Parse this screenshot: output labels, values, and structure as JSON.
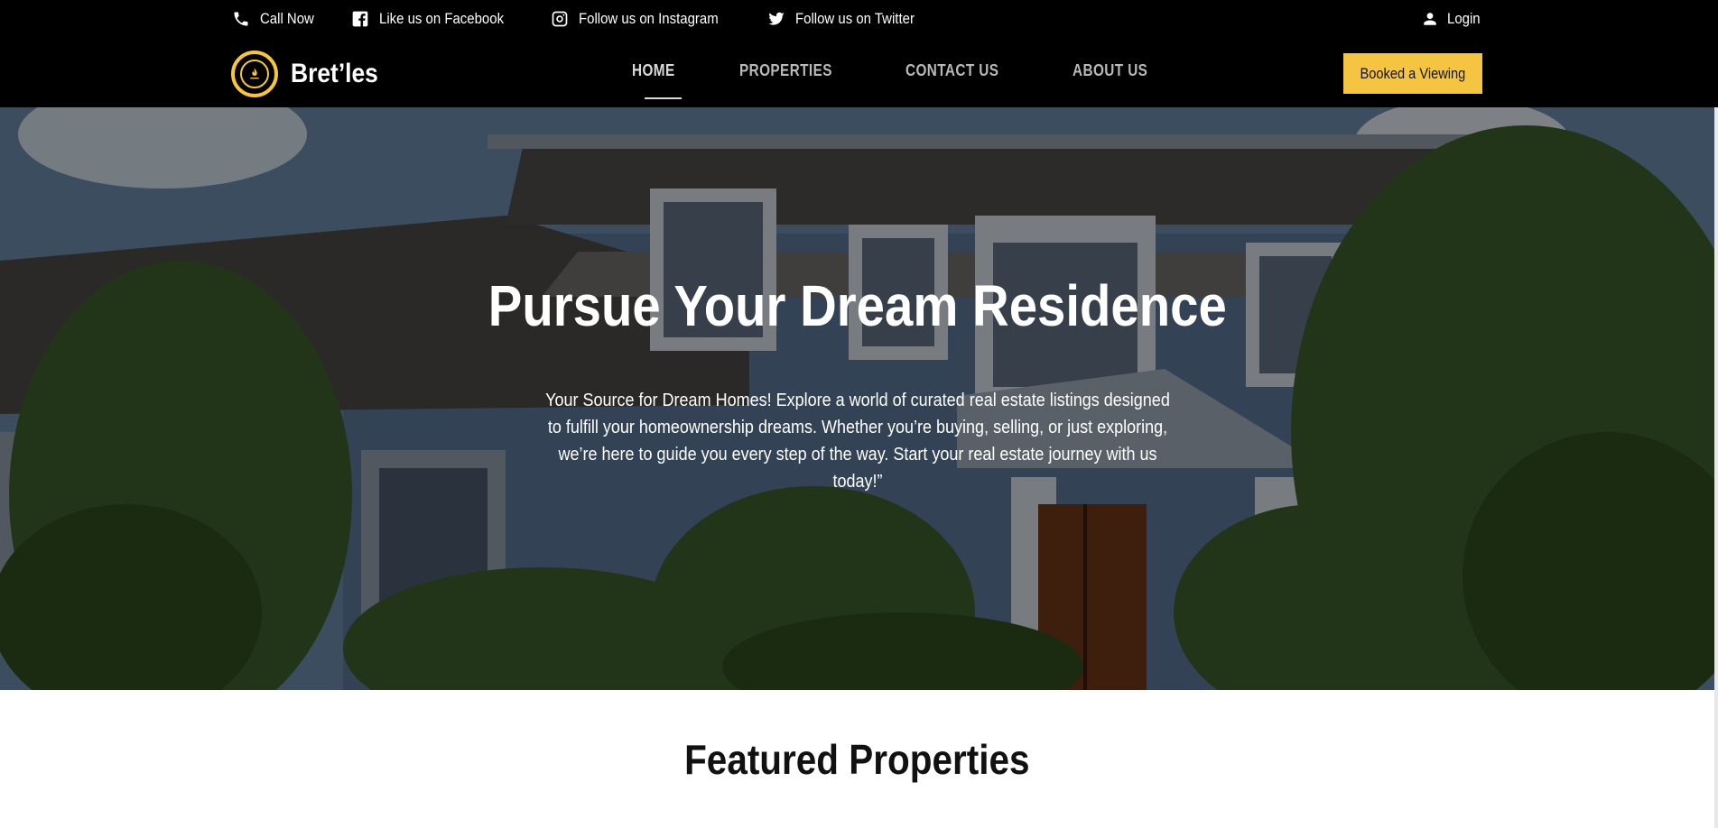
{
  "utility": {
    "call": "Call Now",
    "facebook": "Like us on Facebook",
    "instagram": "Follow us on Instagram",
    "twitter": "Follow us on Twitter",
    "login": "Login"
  },
  "brand": {
    "name": "Bret’les"
  },
  "nav": {
    "home": "HOME",
    "properties": "PROPERTIES",
    "contact": "CONTACT US",
    "about": "ABOUT US",
    "active": "HOME"
  },
  "cta": {
    "label": "Booked a Viewing"
  },
  "hero": {
    "title": "Pursue Your Dream Residence",
    "text": "Your Source for Dream Homes! Explore a world of curated real estate listings designed to fulfill your homeownership dreams. Whether you’re buying, selling, or just exploring, we’re here to guide you every step of the way. Start your real estate journey with us today!”"
  },
  "featured": {
    "title": "Featured Properties"
  },
  "colors": {
    "accent": "#f5c542",
    "header_bg": "#000000"
  },
  "icons": [
    "phone-icon",
    "facebook-icon",
    "instagram-icon",
    "twitter-icon",
    "user-icon",
    "logo-icon"
  ]
}
